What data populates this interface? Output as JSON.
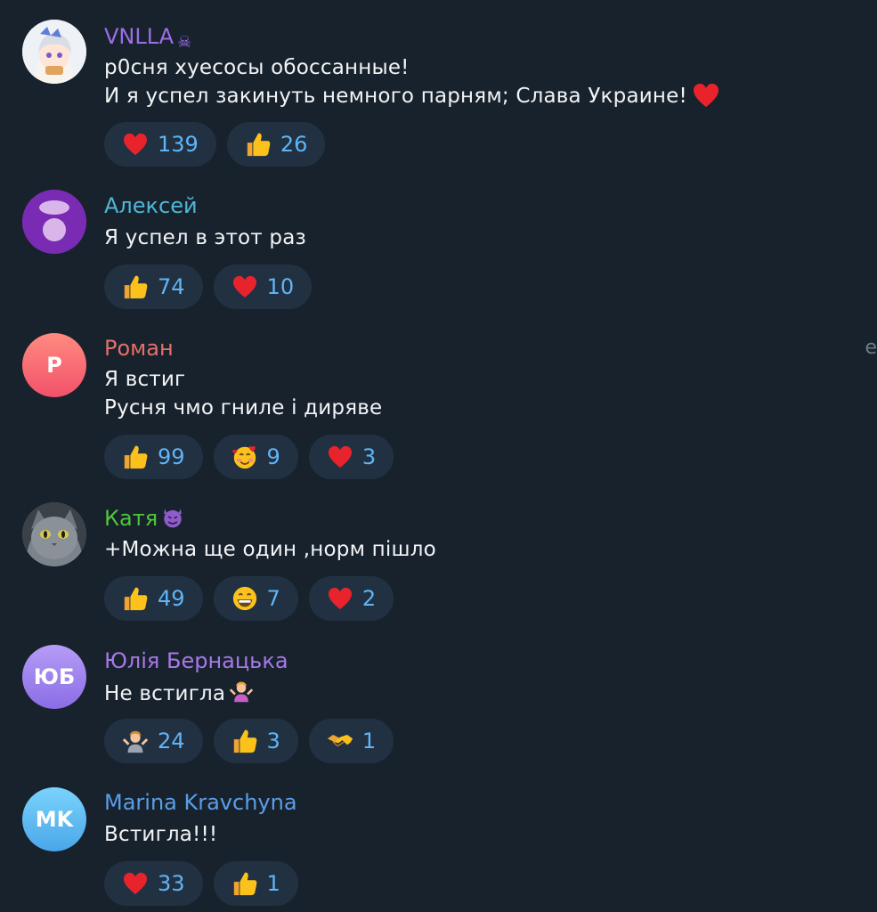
{
  "side_char": "e",
  "comments": [
    {
      "author": "VNLLA",
      "author_suffix": "☠",
      "author_color": "#9b6fe8",
      "lines": [
        "p0сня хуесосы обоссанные!",
        "И я успел закинуть немного парням; Слава Украине!"
      ],
      "reactions": [
        {
          "emoji": "red-heart",
          "count": "139"
        },
        {
          "emoji": "thumbs-up",
          "count": "26"
        }
      ]
    },
    {
      "author": "Алексей",
      "author_color": "#4fb6d6",
      "lines": [
        "Я успел в этот раз"
      ],
      "reactions": [
        {
          "emoji": "thumbs-up",
          "count": "74"
        },
        {
          "emoji": "red-heart",
          "count": "10"
        }
      ]
    },
    {
      "author": "Роман",
      "author_color": "#e4706b",
      "avatar_initials": "Р",
      "lines": [
        "Я встиг",
        "Русня чмо гниле і диряве"
      ],
      "reactions": [
        {
          "emoji": "thumbs-up",
          "count": "99"
        },
        {
          "emoji": "smiling-face-with-hearts",
          "count": "9"
        },
        {
          "emoji": "red-heart",
          "count": "3"
        }
      ]
    },
    {
      "author": "Катя",
      "author_color": "#4ec53a",
      "lines": [
        "+Можна ще один ,норм пішло"
      ],
      "reactions": [
        {
          "emoji": "thumbs-up",
          "count": "49"
        },
        {
          "emoji": "grinning-face",
          "count": "7"
        },
        {
          "emoji": "red-heart",
          "count": "2"
        }
      ]
    },
    {
      "author": "Юлія Бернацька",
      "author_color": "#a778e8",
      "avatar_initials": "ЮБ",
      "lines": [
        "Не встигла"
      ],
      "reactions": [
        {
          "emoji": "person-shrugging",
          "count": "24"
        },
        {
          "emoji": "thumbs-up",
          "count": "3"
        },
        {
          "emoji": "handshake",
          "count": "1"
        }
      ]
    },
    {
      "author": "Marina Kravchyna",
      "author_color": "#5a9ee8",
      "avatar_initials": "MK",
      "lines": [
        "Встигла!!!"
      ],
      "reactions": [
        {
          "emoji": "red-heart",
          "count": "33"
        },
        {
          "emoji": "thumbs-up",
          "count": "1"
        }
      ]
    }
  ]
}
